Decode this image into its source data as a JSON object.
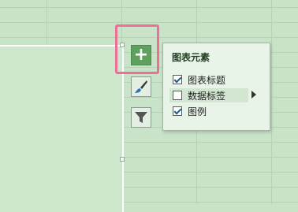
{
  "chart_elements_panel": {
    "title": "图表元素",
    "options": [
      {
        "label": "图表标题",
        "checked": true
      },
      {
        "label": "数据标签",
        "checked": false
      },
      {
        "label": "图例",
        "checked": true
      }
    ]
  },
  "side_buttons": {
    "add_icon": "plus-icon",
    "style_icon": "paintbrush-icon",
    "filter_icon": "funnel-icon"
  },
  "colors": {
    "highlight": "#ef6e98",
    "add_button": "#5da15d",
    "background": "#c8e3c8"
  }
}
